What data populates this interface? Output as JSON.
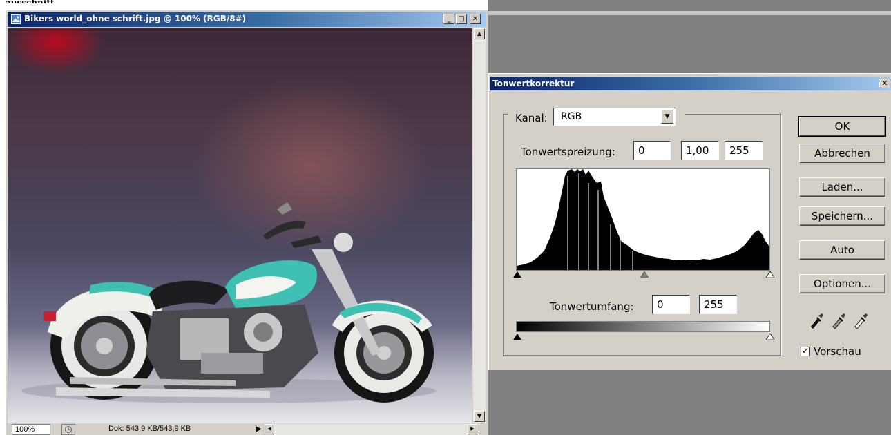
{
  "top_fragment": "ausschnitt",
  "document_window": {
    "title": "Bikers world_ohne schrift.jpg @ 100% (RGB/8#)",
    "buttons": {
      "minimize": "_",
      "maximize": "□",
      "close": "✕"
    },
    "zoom": "100%",
    "doc_info": "Dok: 543,9 KB/543,9 KB"
  },
  "levels_dialog": {
    "title": "Tonwertkorrektur",
    "close": "✕",
    "channel_label": "Kanal:",
    "channel_value": "RGB",
    "input_levels_label": "Tonwertspreizung:",
    "input_black": "0",
    "input_gamma": "1,00",
    "input_white": "255",
    "output_levels_label": "Tonwertumfang:",
    "output_black": "0",
    "output_white": "255",
    "buttons": {
      "ok": "OK",
      "cancel": "Abbrechen",
      "load": "Laden...",
      "save": "Speichern...",
      "auto": "Auto",
      "options": "Optionen..."
    },
    "preview_label": "Vorschau",
    "preview_checked": true,
    "eyedroppers": [
      "black-eyedropper-icon",
      "gray-eyedropper-icon",
      "white-eyedropper-icon"
    ]
  },
  "colors": {
    "title_gradient_start": "#0a246a",
    "title_gradient_end": "#a6caf0",
    "dialog_face": "#d4d0c8",
    "workspace": "#808080"
  }
}
